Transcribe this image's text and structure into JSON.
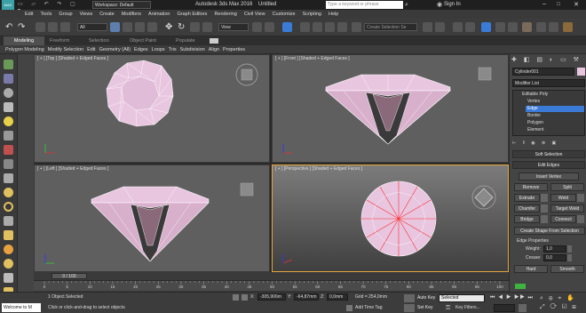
{
  "title_bar": {
    "workspace": "Workspace: Default",
    "app_title": "Autodesk 3ds Max 2016",
    "doc": "Untitled",
    "search_placeholder": "Type a keyword or phrase",
    "signin": "Sign In"
  },
  "menu": [
    "Edit",
    "Tools",
    "Group",
    "Views",
    "Create",
    "Modifiers",
    "Animation",
    "Graph Editors",
    "Rendering",
    "Civil View",
    "Customize",
    "Scripting",
    "Help"
  ],
  "toolbar": {
    "filter": "All",
    "view": "View",
    "selection_set": "Create Selection Se"
  },
  "ribbon_tabs": [
    "Modeling",
    "Freeform",
    "Selection",
    "Object Paint",
    "Populate"
  ],
  "ribbon_items": [
    "Polygon Modeling",
    "Modify Selection",
    "Edit",
    "Geometry (All)",
    "Edges",
    "Loops",
    "Tris",
    "Subdivision",
    "Align",
    "Properties"
  ],
  "viewports": {
    "top": "[ + ] [Top ] [Shaded + Edged Faces ]",
    "front": "[ + ] [Front ] [Shaded + Edged Faces ]",
    "left": "[ + ] [Left ] [Shaded + Edged Faces ]",
    "persp": "[ + ] [Perspective ] [Shaded + Edged Faces ]"
  },
  "command_panel": {
    "object_name": "Cylinder001",
    "modifier_list": "Modifier List",
    "stack": [
      "Editable Poly",
      "Vertex",
      "Edge",
      "Border",
      "Polygon",
      "Element"
    ],
    "soft_selection": "Soft Selection",
    "edit_edges": "Edit Edges",
    "insert_vertex": "Insert Vertex",
    "remove": "Remove",
    "split": "Split",
    "extrude": "Extrude",
    "weld": "Weld",
    "chamfer": "Chamfer",
    "target_weld": "Target Weld",
    "bridge": "Bridge",
    "connect": "Connect",
    "create_shape": "Create Shape From Selection",
    "edge_properties": "Edge Properties",
    "weight_label": "Weight:",
    "weight": "1,0",
    "crease_label": "Crease:",
    "crease": "0,0",
    "hard": "Hard",
    "smooth": "Smooth"
  },
  "trackbar": {
    "frame": "0 / 100",
    "ticks": [
      "0",
      "5",
      "10",
      "15",
      "20",
      "25",
      "30",
      "35",
      "40",
      "45",
      "50",
      "55",
      "60",
      "65",
      "70",
      "75",
      "80",
      "85",
      "90",
      "95",
      "100"
    ]
  },
  "status": {
    "script_listener": "Welcome to M",
    "selected": "1 Object Selected",
    "prompt": "Click or click-and-drag to select objects",
    "x_label": "X:",
    "x": "-305,906m",
    "y_label": "Y:",
    "y": "-64,87mm",
    "z_label": "Z:",
    "z": "0,0mm",
    "grid": "Grid = 254,0mm",
    "add_time_tag": "Add Time Tag",
    "auto_key": "Auto Key",
    "selected_dd": "Selected",
    "set_key": "Set Key",
    "key_filters": "Key Filters..."
  },
  "colors": {
    "gem_fill": "#e8c6e0",
    "gem_edge": "#ffffff",
    "selected_edge": "#ff2b2b",
    "active_border": "#e5a63c",
    "accent_blue": "#3b7bd8"
  }
}
